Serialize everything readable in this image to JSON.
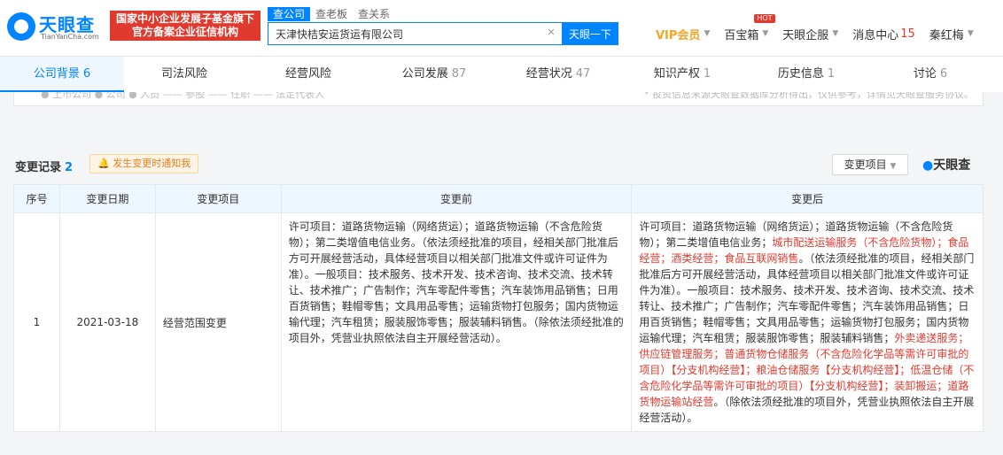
{
  "header": {
    "brand": "天眼查",
    "brand_sub": "TianYanCha.com",
    "gov_badge_line1": "国家中小企业发展子基金旗下",
    "gov_badge_line2": "官方备案企业征信机构",
    "search_tabs": [
      "查公司",
      "查老板",
      "查关系"
    ],
    "search_value": "天津快桔安运货运有限公司",
    "search_button": "天眼一下",
    "nav": {
      "vip": "VIP会员",
      "treasure": "百宝箱",
      "hot": "HOT",
      "enterprise": "天眼企服",
      "messages": "消息中心",
      "message_count": "15",
      "user": "秦红梅"
    }
  },
  "tabs": [
    {
      "label": "公司背景",
      "count": "6"
    },
    {
      "label": "司法风险",
      "count": ""
    },
    {
      "label": "经营风险",
      "count": ""
    },
    {
      "label": "公司发展",
      "count": "87"
    },
    {
      "label": "经营状况",
      "count": "47"
    },
    {
      "label": "知识产权",
      "count": "1"
    },
    {
      "label": "历史信息",
      "count": "1"
    },
    {
      "label": "讨论",
      "count": "6"
    }
  ],
  "strip": {
    "legend": "● 上市公司  ● 公司  ● 人员  —— 参股  —— 任职  —— 法定代表人",
    "note": "* 投资信息来源天眼查数据库分析得出，仅供参考，详情见天眼查服务协议。"
  },
  "section": {
    "title": "变更记录",
    "count": "2",
    "notify": "发生变更时通知我",
    "filter": "变更项目",
    "logo": "天眼查"
  },
  "table": {
    "headers": [
      "序号",
      "变更日期",
      "变更项目",
      "变更前",
      "变更后"
    ],
    "rows": [
      {
        "num": "1",
        "date": "2021-03-18",
        "item": "经营范围变更",
        "before": "许可项目：道路货物运输（网络货运）；道路货物运输（不含危险货物）；第二类增值电信业务。（依法须经批准的项目，经相关部门批准后方可开展经营活动，具体经营项目以相关部门批准文件或许可证件为准）。一般项目：技术服务、技术开发、技术咨询、技术交流、技术转让、技术推广；广告制作；汽车零配件零售；汽车装饰用品销售；日用百货销售；鞋帽零售；文具用品零售；运输货物打包服务；国内货物运输代理；汽车租赁；服装服饰零售；服装辅料销售。（除依法须经批准的项目外，凭营业执照依法自主开展经营活动）。",
        "after_parts": [
          {
            "text": "许可项目：道路货物运输（网络货运）；道路货物运输（不含危险货物）；第二类增值电信业务；",
            "hl": false
          },
          {
            "text": "城市配送运输服务（不含危险货物）；食品经营；酒类经营；食品互联网销售",
            "hl": true
          },
          {
            "text": "。（依法须经批准的项目，经相关部门批准后方可开展经营活动，具体经营项目以相关部门批准文件或许可证件为准）。一般项目：技术服务、技术开发、技术咨询、技术交流、技术转让、技术推广；广告制作；汽车零配件零售；汽车装饰用品销售；日用百货销售；鞋帽零售；文具用品零售；运输货物打包服务；国内货物运输代理；汽车租赁；服装服饰零售；服装辅料销售；",
            "hl": false
          },
          {
            "text": "外卖递送服务；供应链管理服务；普通货物仓储服务（不含危险化学品等需许可审批的项目）【分支机构经营】；粮油仓储服务【分支机构经营】；低温仓储（不含危险化学品等需许可审批的项目）【分支机构经营】；装卸搬运；道路货物运输站经营",
            "hl": true
          },
          {
            "text": "。（除依法须经批准的项目外，凭营业执照依法自主开展经营活动）。",
            "hl": false
          }
        ]
      }
    ]
  }
}
